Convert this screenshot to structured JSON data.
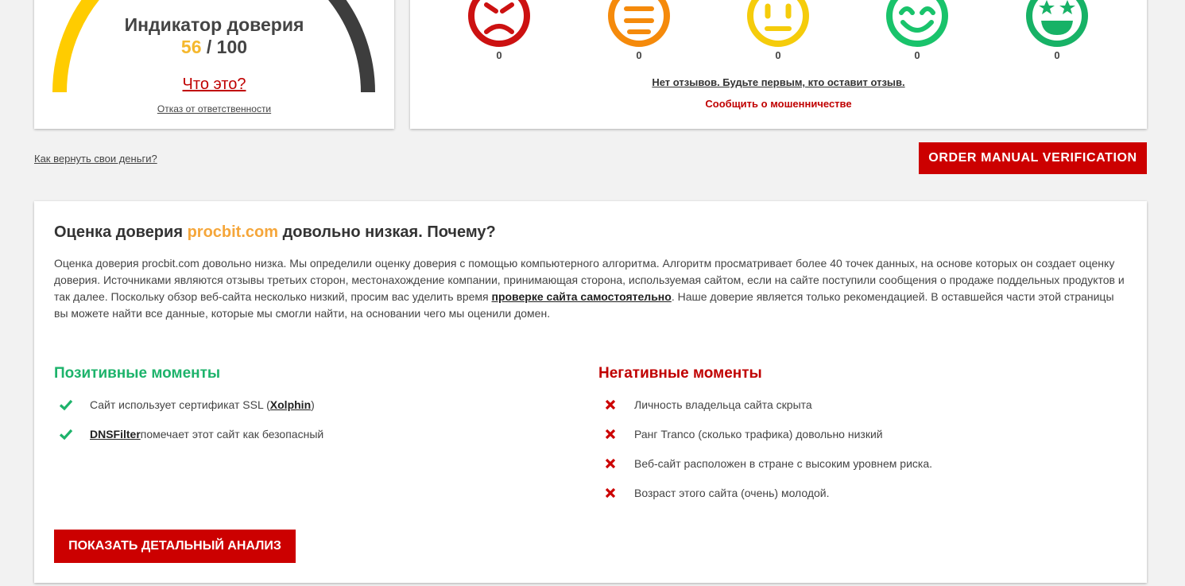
{
  "trust": {
    "title": "Индикатор доверия",
    "score": "56",
    "score_max": "/ 100",
    "score_fraction": 0.56,
    "what_link": "Что это?",
    "disclaimer": "Отказ от ответственности"
  },
  "reviews": {
    "faces": [
      {
        "icon": "angry-face-icon",
        "color": "#cc1111",
        "count": "0"
      },
      {
        "icon": "unhappy-face-icon",
        "color": "#f58a0b",
        "count": "0"
      },
      {
        "icon": "neutral-face-icon",
        "color": "#f5cc0b",
        "count": "0"
      },
      {
        "icon": "smiling-face-icon",
        "color": "#19c36b",
        "count": "0"
      },
      {
        "icon": "star-eyes-face-icon",
        "color": "#17b266",
        "count": "0"
      }
    ],
    "no_reviews": "Нет отзывов. Будьте первым, кто оставит отзыв.",
    "report_fraud": "Сообщить о мошенничестве"
  },
  "refund_link": "Как вернуть свои деньги?",
  "order_button": "ORDER MANUAL VERIFICATION",
  "analysis": {
    "title_pre": "Оценка доверия ",
    "domain": "procbit.com",
    "title_post": " довольно низкая. Почему?",
    "text_part1": "Оценка доверия procbit.com довольно низка. Мы определили оценку доверия с помощью компьютерного алгоритма. Алгоритм просматривает более 40 точек данных, на основе которых он создает оценку доверия. Источниками являются отзывы третьих сторон, местонахождение компании, принимающая сторона, используемая сайтом, если на сайте поступили сообщения о продаже поддельных продуктов и так далее. Поскольку обзор веб-сайта несколько низкий, просим вас уделить время ",
    "text_link": "проверке сайта самостоятельно",
    "text_part2": ". Наше доверие является только рекомендацией. В оставшейся части этой страницы вы можете найти все данные, которые мы смогли найти, на основании чего мы оценили домен.",
    "positive_title": "Позитивные моменты",
    "negative_title": "Негативные моменты",
    "positive_1_pre": "Сайт использует сертификат SSL (",
    "positive_1_link": "Xolphin",
    "positive_1_post": ")",
    "positive_2_link": "DNSFilter",
    "positive_2_post": " помечает этот сайт как безопасный",
    "negative": [
      "Личность владельца сайта скрыта",
      "Ранг Tranco (сколько трафика) довольно низкий",
      "Веб-сайт расположен в стране с высоким уровнем риска.",
      "Возраст этого сайта (очень) молодой."
    ],
    "detail_button": "ПОКАЗАТЬ ДЕТАЛЬНЫЙ АНАЛИЗ"
  },
  "colors": {
    "accent_red": "#cc0000",
    "positive_green": "#1db36b",
    "gauge_yellow": "#ffcc00",
    "gauge_dark": "#3d3d3d"
  }
}
